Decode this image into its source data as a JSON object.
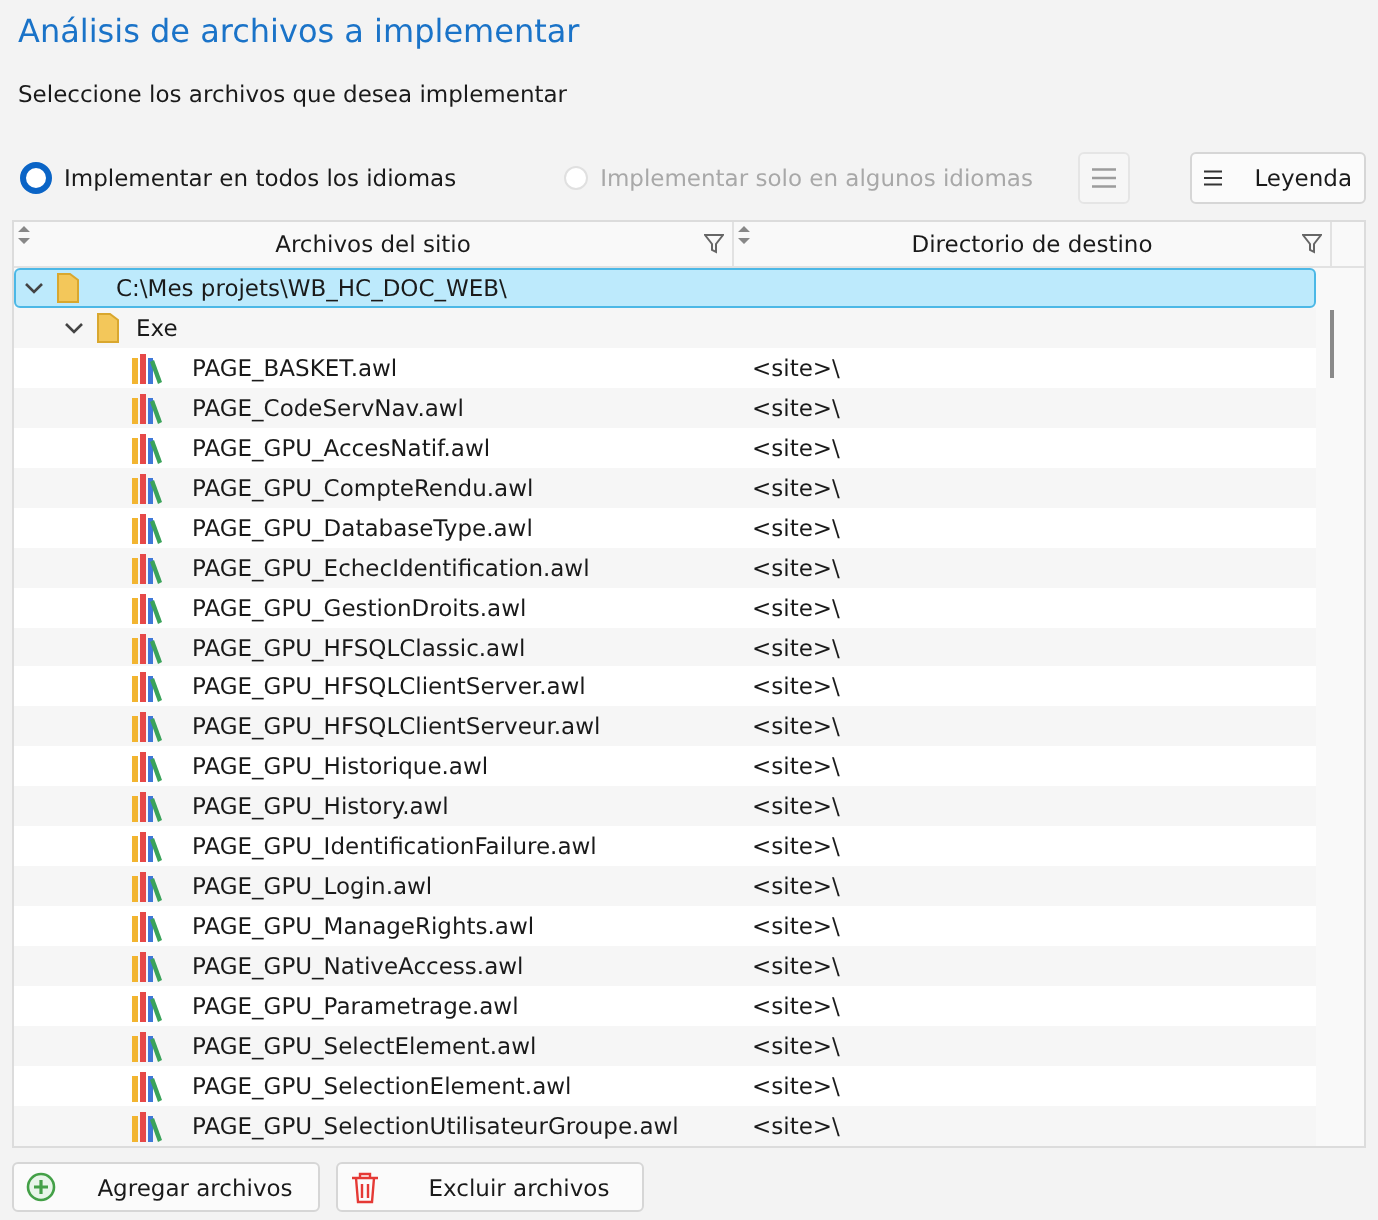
{
  "title": "Análisis de archivos a implementar",
  "subtitle": "Seleccione los archivos que desea implementar",
  "options": [
    {
      "label": "Implementar en todos los idiomas",
      "selected": true,
      "disabled": false
    },
    {
      "label": "Implementar solo en algunos idiomas",
      "selected": false,
      "disabled": true
    }
  ],
  "toolbar": [
    {
      "kind": "icon",
      "disabled": true
    },
    {
      "kind": "labeled",
      "label": "Leyenda",
      "disabled": false
    }
  ],
  "table": {
    "columns": [
      "Archivos del sitio",
      "Directorio de destino"
    ],
    "tree": [
      {
        "kind": "folder",
        "name": "C:\\Mes projets\\WB_HC_DOC_WEB\\",
        "expanded": true,
        "selected": true,
        "children": [
          {
            "kind": "folder",
            "name": "Exe",
            "expanded": true,
            "selected": false,
            "children": [
              {
                "kind": "file",
                "name": "PAGE_BASKET.awl",
                "destination": "<site>\\",
                "selected": false
              },
              {
                "kind": "file",
                "name": "PAGE_CodeServNav.awl",
                "destination": "<site>\\",
                "selected": false
              },
              {
                "kind": "file",
                "name": "PAGE_GPU_AccesNatif.awl",
                "destination": "<site>\\",
                "selected": false
              },
              {
                "kind": "file",
                "name": "PAGE_GPU_CompteRendu.awl",
                "destination": "<site>\\",
                "selected": false
              },
              {
                "kind": "file",
                "name": "PAGE_GPU_DatabaseType.awl",
                "destination": "<site>\\",
                "selected": false
              },
              {
                "kind": "file",
                "name": "PAGE_GPU_EchecIdentification.awl",
                "destination": "<site>\\",
                "selected": false
              },
              {
                "kind": "file",
                "name": "PAGE_GPU_GestionDroits.awl",
                "destination": "<site>\\",
                "selected": false
              },
              {
                "kind": "file",
                "name": "PAGE_GPU_HFSQLClassic.awl",
                "destination": "<site>\\",
                "selected": false
              },
              {
                "kind": "file",
                "name": "PAGE_GPU_HFSQLClientServer.awl",
                "destination": "<site>\\",
                "selected": false
              },
              {
                "kind": "file",
                "name": "PAGE_GPU_HFSQLClientServeur.awl",
                "destination": "<site>\\",
                "selected": false
              },
              {
                "kind": "file",
                "name": "PAGE_GPU_Historique.awl",
                "destination": "<site>\\",
                "selected": false
              },
              {
                "kind": "file",
                "name": "PAGE_GPU_History.awl",
                "destination": "<site>\\",
                "selected": false
              },
              {
                "kind": "file",
                "name": "PAGE_GPU_IdentificationFailure.awl",
                "destination": "<site>\\",
                "selected": false
              },
              {
                "kind": "file",
                "name": "PAGE_GPU_Login.awl",
                "destination": "<site>\\",
                "selected": false
              },
              {
                "kind": "file",
                "name": "PAGE_GPU_ManageRights.awl",
                "destination": "<site>\\",
                "selected": false
              },
              {
                "kind": "file",
                "name": "PAGE_GPU_NativeAccess.awl",
                "destination": "<site>\\",
                "selected": false
              },
              {
                "kind": "file",
                "name": "PAGE_GPU_Parametrage.awl",
                "destination": "<site>\\",
                "selected": false
              },
              {
                "kind": "file",
                "name": "PAGE_GPU_SelectElement.awl",
                "destination": "<site>\\",
                "selected": false
              },
              {
                "kind": "file",
                "name": "PAGE_GPU_SelectionElement.awl",
                "destination": "<site>\\",
                "selected": false
              },
              {
                "kind": "file",
                "name": "PAGE_GPU_SelectionUtilisateurGroupe.awl",
                "destination": "<site>\\",
                "selected": false
              }
            ]
          }
        ]
      }
    ]
  },
  "buttons": [
    {
      "kind": "add",
      "label": "Agregar archivos"
    },
    {
      "kind": "remove",
      "label": "Excluir archivos"
    }
  ]
}
